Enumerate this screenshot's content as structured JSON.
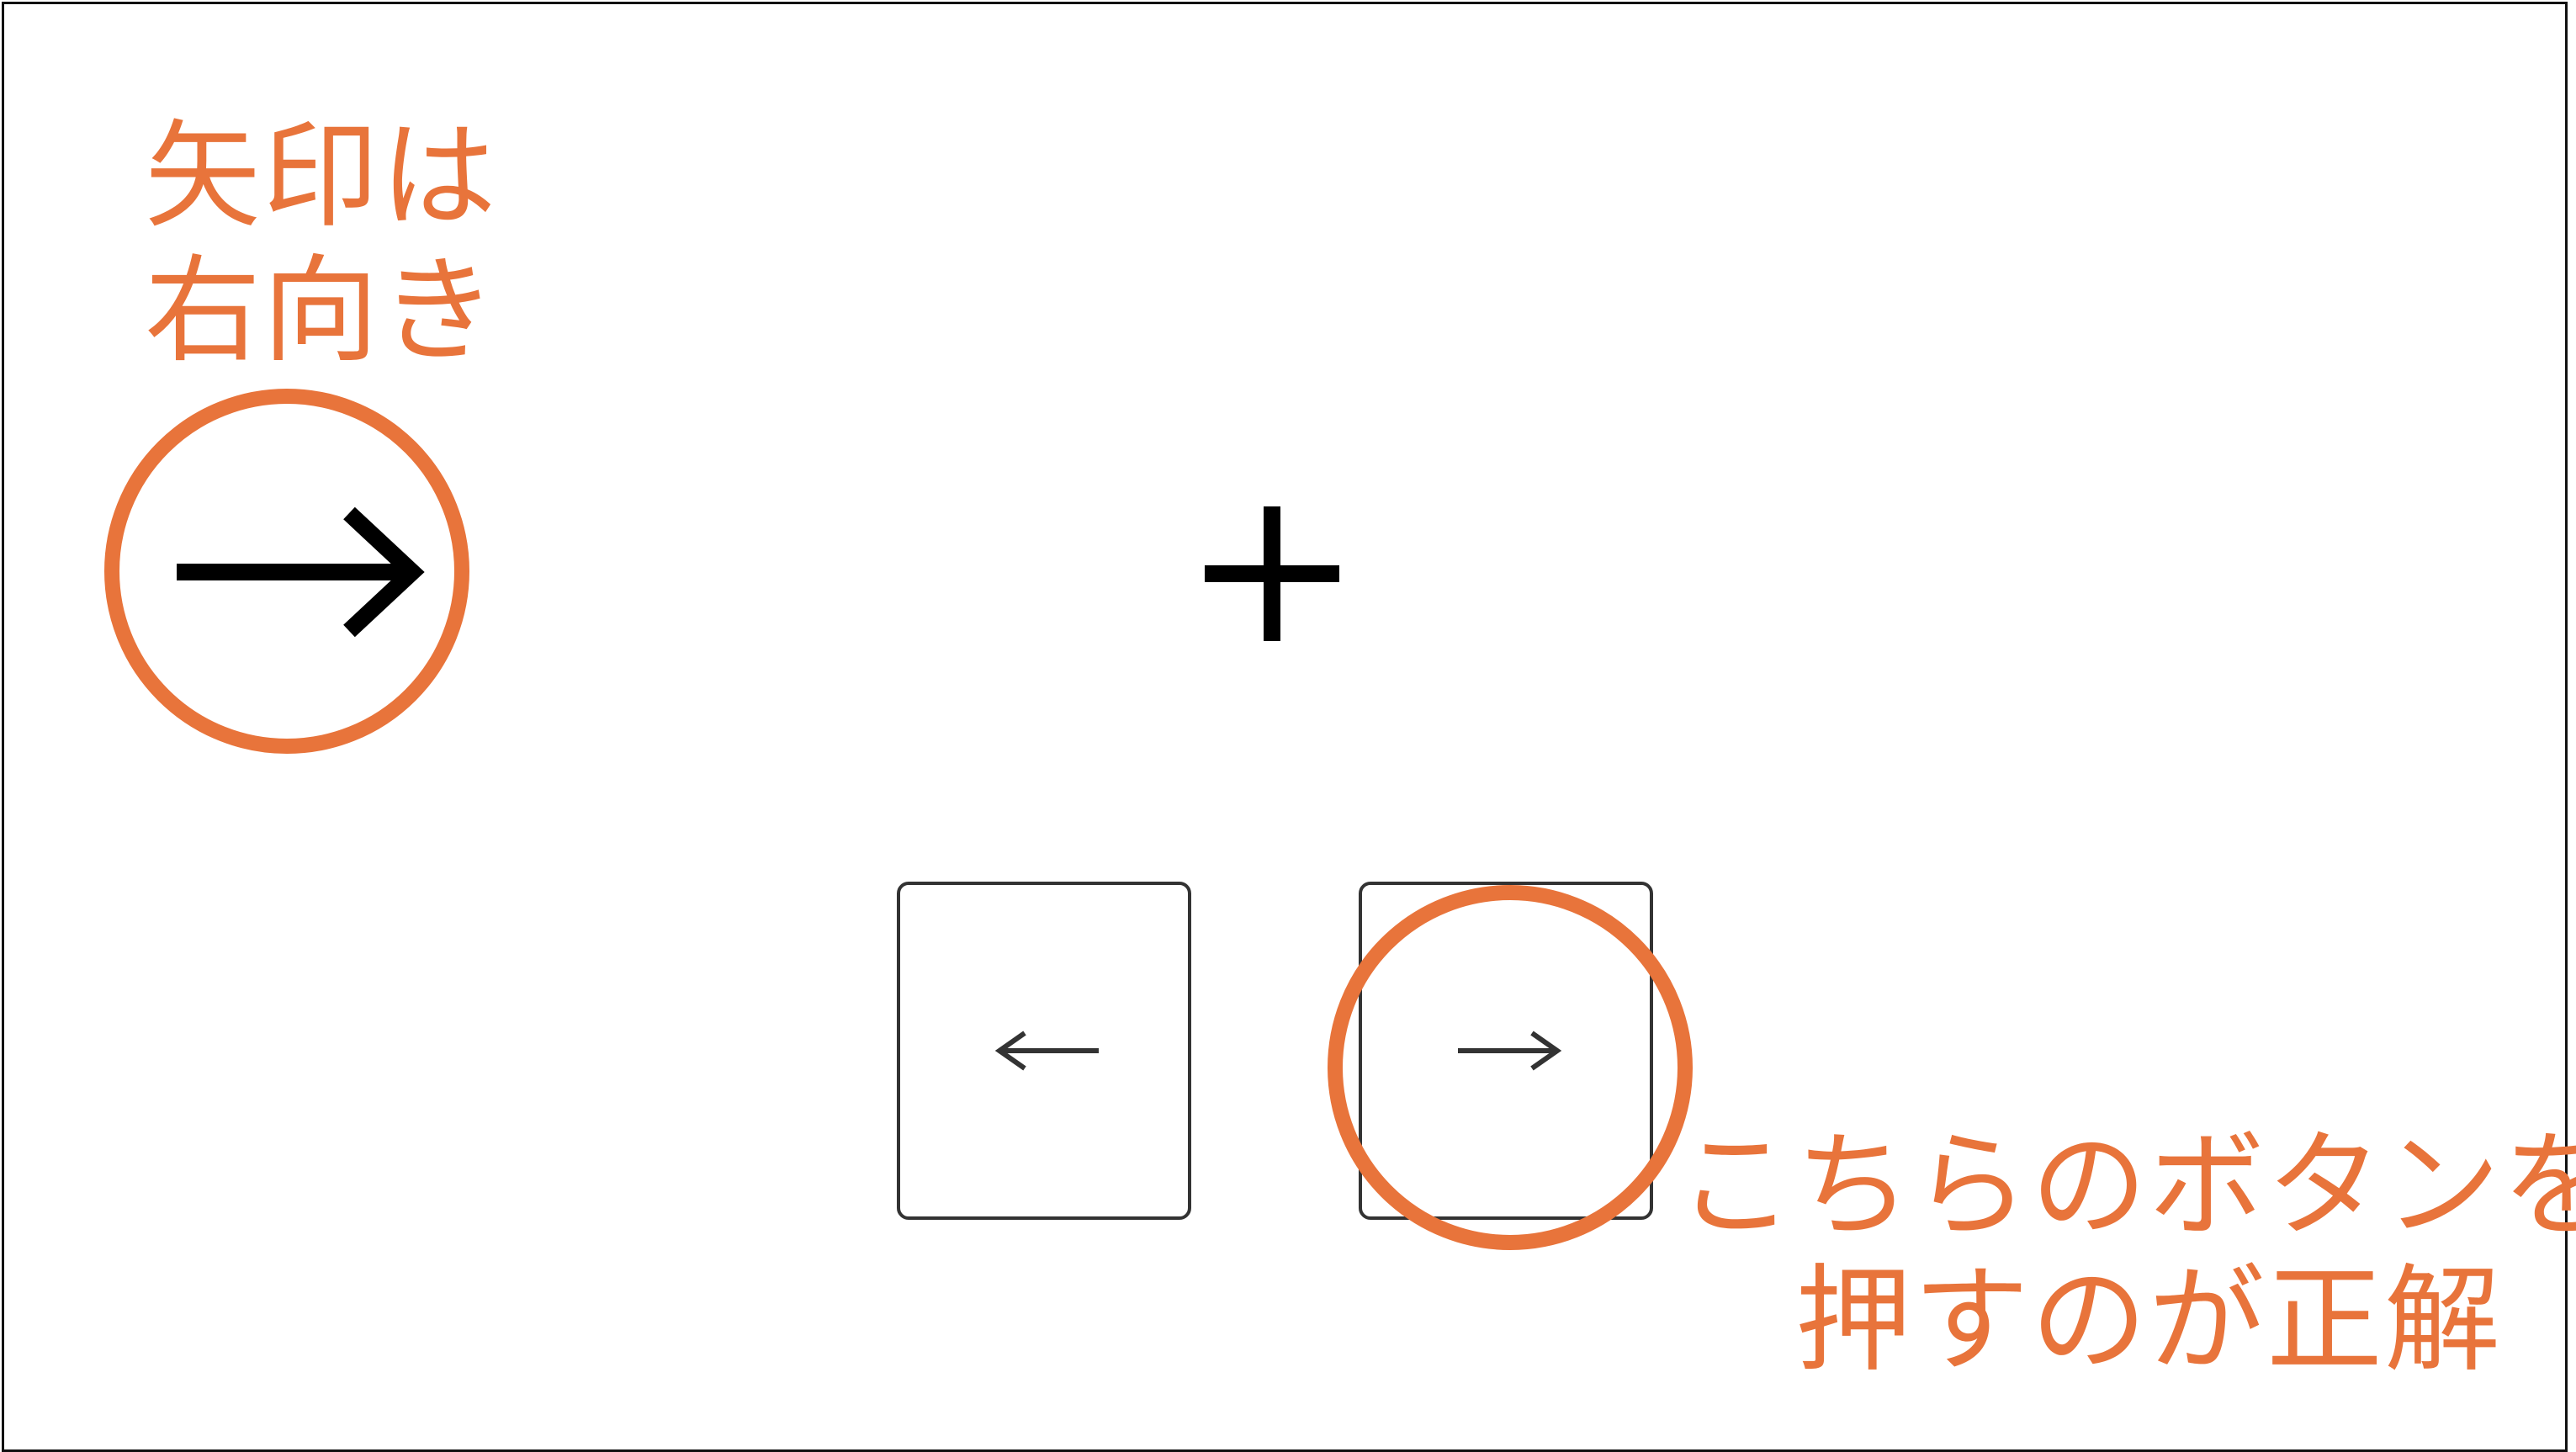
{
  "annotations": {
    "cue_note": [
      "矢印は",
      "右向き"
    ],
    "answer_note": [
      "こちらのボタンを",
      "押すのが正解"
    ],
    "accent_color": "#e8743b"
  },
  "stimulus": {
    "cue_icon": "arrow-right-icon",
    "fixation_icon": "plus-icon"
  },
  "buttons": [
    {
      "id": "left",
      "icon": "arrow-left-icon"
    },
    {
      "id": "right",
      "icon": "arrow-right-icon"
    }
  ]
}
